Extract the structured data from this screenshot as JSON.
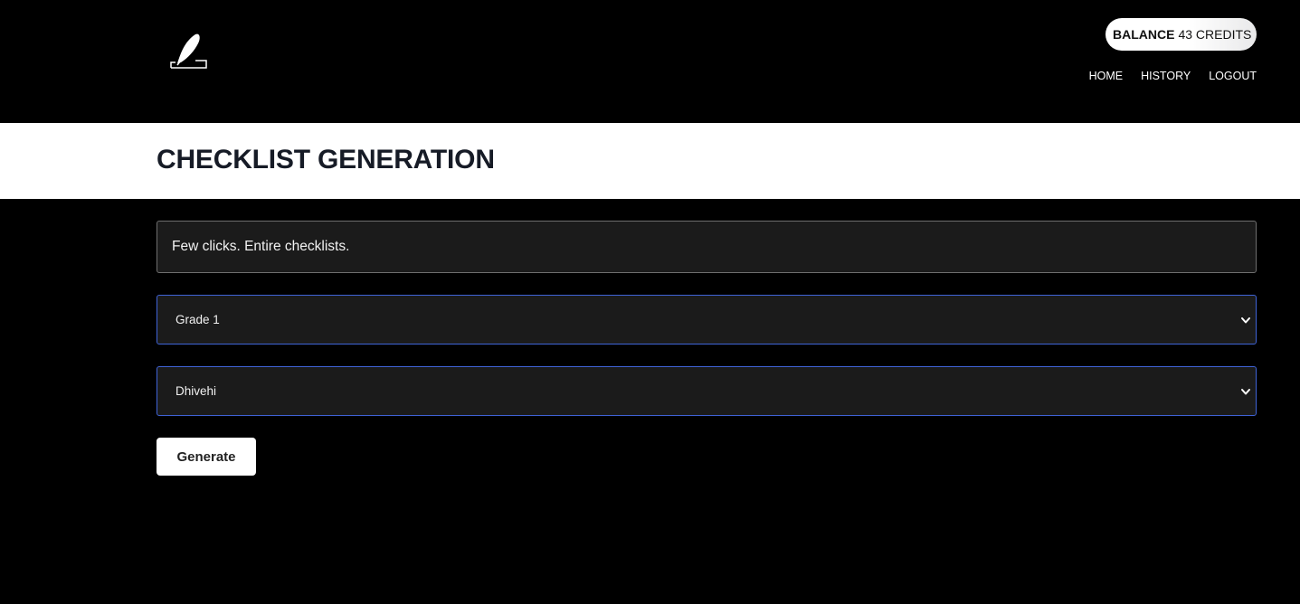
{
  "header": {
    "logo_icon": "quill-feather-icon",
    "balance": {
      "label": "BALANCE",
      "value": "43 CREDITS"
    },
    "nav": {
      "home": "HOME",
      "history": "HISTORY",
      "logout": "LOGOUT"
    }
  },
  "page": {
    "title": "CHECKLIST GENERATION"
  },
  "form": {
    "tagline": "Few clicks. Entire checklists.",
    "grade_select": {
      "selected": "Grade 1",
      "icon": "chevron-down-icon"
    },
    "language_select": {
      "selected": "Dhivehi",
      "icon": "chevron-down-icon"
    },
    "generate_label": "Generate"
  },
  "colors": {
    "background": "#000000",
    "title_band": "#ffffff",
    "field_bg": "#1b1b1b",
    "select_border": "#3f63d6",
    "title_text": "#161b26"
  }
}
